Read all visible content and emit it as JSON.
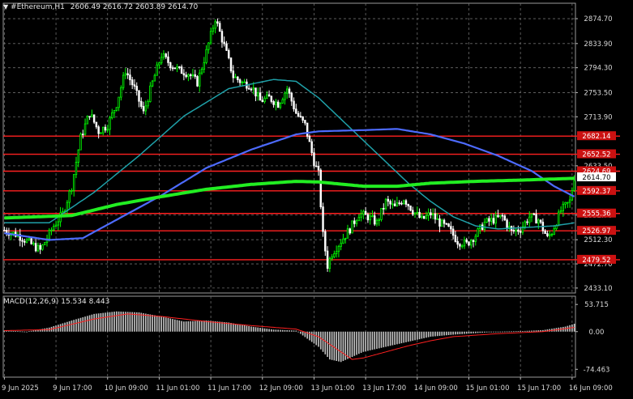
{
  "header": {
    "symbol": "#Ethereum,H1",
    "ohlc": "2606.49 2616.72 2603.89 2614.70",
    "macd_label": "MACD(12,26,9) 15.534 8.443"
  },
  "icons": {
    "collapse": "triangle-down-icon"
  },
  "colors": {
    "background": "#000000",
    "grid": "#6b6b6b",
    "bull_candle": "#00ff00",
    "bear_candle": "#ffffff",
    "ma_fast": "#1fa0a8",
    "ma_mid": "#4d6bff",
    "ma_slow": "#22ee22",
    "levels": "#ff2020",
    "level_label_bg": "#cc1111",
    "price_marker_bg": "#ffffff",
    "macd_hist": "#c0c0c0",
    "macd_signal": "#ff2020"
  },
  "price_axis": {
    "ticks": [
      "2874.70",
      "2833.90",
      "2794.30",
      "2753.50",
      "2713.90",
      "2633.50",
      "2552.70",
      "2512.30",
      "2472.70",
      "2433.10"
    ],
    "current_price": "2614.70"
  },
  "levels": [
    "2682.14",
    "2652.52",
    "2624.69",
    "2592.37",
    "2555.36",
    "2526.97",
    "2479.52"
  ],
  "macd_axis": {
    "ticks": [
      "53.715",
      "0.00",
      "-74.463"
    ]
  },
  "time_axis": {
    "labels": [
      "9 Jun 2025",
      "9 Jun 17:00",
      "10 Jun 09:00",
      "11 Jun 01:00",
      "11 Jun 17:00",
      "12 Jun 09:00",
      "13 Jun 01:00",
      "13 Jun 17:00",
      "14 Jun 09:00",
      "15 Jun 01:00",
      "15 Jun 17:00",
      "16 Jun 09:00"
    ]
  },
  "chart_data": {
    "type": "candlestick",
    "symbol": "#Ethereum",
    "timeframe": "H1",
    "price_range": [
      2425,
      2900
    ],
    "macd_range": [
      -90,
      70
    ],
    "grid": true,
    "anchors": [
      [
        0,
        2528
      ],
      [
        6,
        2520
      ],
      [
        12,
        2505
      ],
      [
        16,
        2495
      ],
      [
        22,
        2535
      ],
      [
        26,
        2555
      ],
      [
        30,
        2600
      ],
      [
        34,
        2680
      ],
      [
        38,
        2720
      ],
      [
        42,
        2690
      ],
      [
        46,
        2700
      ],
      [
        50,
        2735
      ],
      [
        54,
        2790
      ],
      [
        58,
        2760
      ],
      [
        62,
        2720
      ],
      [
        66,
        2770
      ],
      [
        70,
        2815
      ],
      [
        74,
        2800
      ],
      [
        78,
        2790
      ],
      [
        82,
        2785
      ],
      [
        86,
        2770
      ],
      [
        90,
        2820
      ],
      [
        94,
        2875
      ],
      [
        98,
        2830
      ],
      [
        102,
        2780
      ],
      [
        106,
        2770
      ],
      [
        110,
        2765
      ],
      [
        114,
        2740
      ],
      [
        118,
        2745
      ],
      [
        122,
        2735
      ],
      [
        126,
        2760
      ],
      [
        130,
        2720
      ],
      [
        134,
        2700
      ],
      [
        138,
        2640
      ],
      [
        140,
        2620
      ],
      [
        142,
        2520
      ],
      [
        144,
        2470
      ],
      [
        146,
        2490
      ],
      [
        150,
        2510
      ],
      [
        154,
        2530
      ],
      [
        158,
        2555
      ],
      [
        162,
        2550
      ],
      [
        166,
        2540
      ],
      [
        170,
        2575
      ],
      [
        174,
        2565
      ],
      [
        178,
        2580
      ],
      [
        182,
        2560
      ],
      [
        186,
        2545
      ],
      [
        190,
        2555
      ],
      [
        194,
        2540
      ],
      [
        198,
        2530
      ],
      [
        202,
        2510
      ],
      [
        206,
        2505
      ],
      [
        210,
        2520
      ],
      [
        214,
        2540
      ],
      [
        218,
        2545
      ],
      [
        222,
        2550
      ],
      [
        226,
        2525
      ],
      [
        230,
        2530
      ],
      [
        234,
        2550
      ],
      [
        238,
        2545
      ],
      [
        242,
        2515
      ],
      [
        244,
        2525
      ],
      [
        248,
        2560
      ],
      [
        252,
        2575
      ],
      [
        254,
        2615
      ]
    ],
    "ma_fast": [
      [
        0,
        2540
      ],
      [
        20,
        2540
      ],
      [
        40,
        2590
      ],
      [
        60,
        2650
      ],
      [
        80,
        2715
      ],
      [
        100,
        2760
      ],
      [
        120,
        2775
      ],
      [
        130,
        2772
      ],
      [
        140,
        2745
      ],
      [
        150,
        2710
      ],
      [
        160,
        2675
      ],
      [
        170,
        2640
      ],
      [
        180,
        2605
      ],
      [
        190,
        2575
      ],
      [
        200,
        2550
      ],
      [
        210,
        2535
      ],
      [
        220,
        2530
      ],
      [
        230,
        2532
      ],
      [
        245,
        2535
      ],
      [
        254,
        2540
      ]
    ],
    "ma_mid": [
      [
        0,
        2523
      ],
      [
        20,
        2512
      ],
      [
        35,
        2515
      ],
      [
        50,
        2545
      ],
      [
        70,
        2585
      ],
      [
        90,
        2630
      ],
      [
        110,
        2660
      ],
      [
        130,
        2685
      ],
      [
        140,
        2690
      ],
      [
        160,
        2692
      ],
      [
        175,
        2694
      ],
      [
        190,
        2685
      ],
      [
        205,
        2670
      ],
      [
        220,
        2650
      ],
      [
        235,
        2625
      ],
      [
        245,
        2600
      ],
      [
        254,
        2583
      ]
    ],
    "ma_slow": [
      [
        0,
        2548
      ],
      [
        30,
        2552
      ],
      [
        50,
        2570
      ],
      [
        70,
        2583
      ],
      [
        90,
        2595
      ],
      [
        110,
        2603
      ],
      [
        130,
        2608
      ],
      [
        140,
        2607
      ],
      [
        160,
        2600
      ],
      [
        175,
        2600
      ],
      [
        190,
        2605
      ],
      [
        210,
        2608
      ],
      [
        230,
        2610
      ],
      [
        254,
        2613
      ]
    ],
    "macd": [
      [
        0,
        2
      ],
      [
        10,
        0
      ],
      [
        20,
        8
      ],
      [
        30,
        22
      ],
      [
        40,
        35
      ],
      [
        50,
        40
      ],
      [
        60,
        38
      ],
      [
        70,
        30
      ],
      [
        80,
        20
      ],
      [
        90,
        22
      ],
      [
        100,
        18
      ],
      [
        110,
        10
      ],
      [
        120,
        4
      ],
      [
        130,
        2
      ],
      [
        140,
        -30
      ],
      [
        145,
        -55
      ],
      [
        150,
        -60
      ],
      [
        155,
        -50
      ],
      [
        160,
        -40
      ],
      [
        170,
        -30
      ],
      [
        180,
        -20
      ],
      [
        190,
        -10
      ],
      [
        200,
        -6
      ],
      [
        210,
        -3
      ],
      [
        220,
        0
      ],
      [
        230,
        1
      ],
      [
        240,
        3
      ],
      [
        250,
        10
      ],
      [
        254,
        15.534
      ]
    ],
    "signal": [
      [
        0,
        2
      ],
      [
        20,
        4
      ],
      [
        40,
        25
      ],
      [
        55,
        35
      ],
      [
        70,
        30
      ],
      [
        90,
        20
      ],
      [
        110,
        12
      ],
      [
        130,
        5
      ],
      [
        140,
        -10
      ],
      [
        150,
        -40
      ],
      [
        155,
        -55
      ],
      [
        160,
        -52
      ],
      [
        170,
        -40
      ],
      [
        180,
        -28
      ],
      [
        190,
        -18
      ],
      [
        200,
        -10
      ],
      [
        220,
        -4
      ],
      [
        240,
        0
      ],
      [
        254,
        8.443
      ]
    ]
  }
}
